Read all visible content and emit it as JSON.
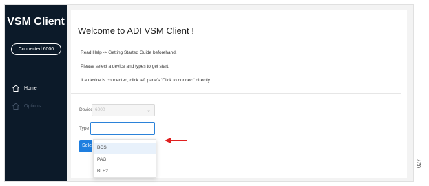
{
  "sidebar": {
    "app_title": "VSM Client",
    "status_label": "Connected 6000",
    "nav": [
      {
        "label": "Home",
        "icon": "home-icon"
      },
      {
        "label": "Options",
        "icon": "home-icon"
      }
    ]
  },
  "main": {
    "title": "Welcome to ADI VSM Client !",
    "instructions": [
      "Read Help -> Getting Started Guide beforehand.",
      "Please select a device and types to get start.",
      "If a device is connected, click left pane's 'Click to connect' directly."
    ],
    "device": {
      "label": "Device",
      "value": "6000",
      "caret_icon": "chevron-down-icon"
    },
    "type": {
      "label": "Type",
      "value": ""
    },
    "select_button_label": "Select",
    "type_options": [
      "BOS",
      "PAG",
      "BLE2"
    ]
  },
  "annotations": {
    "arrow_color": "#e02020",
    "figure_number": "027"
  },
  "colors": {
    "sidebar_bg": "#0c1a29",
    "accent": "#1f7fe0",
    "focus_border": "#2b82d9"
  }
}
